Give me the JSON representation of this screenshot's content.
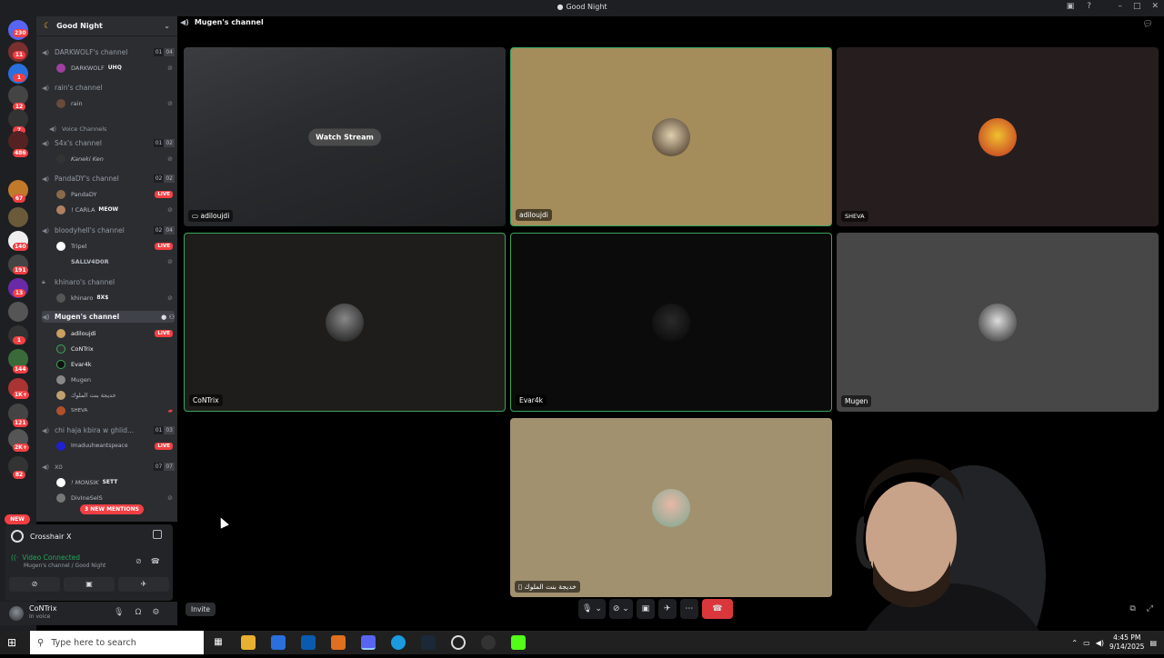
{
  "window": {
    "title": "Good Night",
    "title_icon": "discord-icon"
  },
  "server_rail": {
    "badges": [
      "230",
      "11",
      "1",
      "12",
      "7",
      "486",
      "67",
      "140",
      "191",
      "13",
      "1",
      "144",
      "1K+",
      "121",
      "2K+",
      "82"
    ],
    "new_label": "NEW"
  },
  "sidebar": {
    "guild_name": "Good Night",
    "channels": [
      {
        "name": "DARKWOLF's channel",
        "count": [
          "01",
          "04"
        ]
      },
      {
        "name": "rain's channel"
      },
      {
        "name": "Voice Channels"
      },
      {
        "name": "S4x's channel",
        "count": [
          "01",
          "02"
        ]
      },
      {
        "name": "PandaDY's channel",
        "count": [
          "02",
          "02"
        ]
      },
      {
        "name": "bloodyhell's channel",
        "count": [
          "02",
          "04"
        ]
      },
      {
        "name": "khinaro's channel"
      },
      {
        "name": "Mugen's channel"
      },
      {
        "name": "chi haja kbira w ghlid...",
        "count": [
          "01",
          "03"
        ]
      },
      {
        "name": "xo",
        "count": [
          "07",
          "07"
        ]
      }
    ],
    "users": [
      {
        "name": "DARKWOLF",
        "tag": "UHQ"
      },
      {
        "name": "rain"
      },
      {
        "name": "Kaneki Ken"
      },
      {
        "name": "PandaDY",
        "status": "LIVE"
      },
      {
        "name": "! CARLA",
        "tag": "MEOW"
      },
      {
        "name": "Tripel",
        "status": "LIVE"
      },
      {
        "name": "SALLV4D0R"
      },
      {
        "name": "khinaro",
        "tag": "8X$"
      },
      {
        "name": "adiloujdi",
        "status": "LIVE"
      },
      {
        "name": "CoNTrix"
      },
      {
        "name": "Evar4k"
      },
      {
        "name": "Mugen"
      },
      {
        "name": "خديجة بنت الملوك"
      },
      {
        "name": "SHEVA"
      },
      {
        "name": "Imaduuhwantspeace",
        "status": "LIVE"
      },
      {
        "name": "! MONSIK",
        "tag": "SETT"
      },
      {
        "name": "DivIneSelS"
      }
    ],
    "mentions": "3 NEW MENTIONS"
  },
  "panel": {
    "activity": "Crosshair X",
    "voice_status": "Video Connected",
    "voice_location": "Mugen's channel / Good Night",
    "user_name": "CoNTrix",
    "user_status": "In voice"
  },
  "main": {
    "channel_title": "Mugen's channel",
    "watch_stream": "Watch Stream",
    "tiles": [
      {
        "name": "adiloujdi"
      },
      {
        "name": "adiloujdi"
      },
      {
        "name": "SHEVA"
      },
      {
        "name": "CoNTrix"
      },
      {
        "name": "Evar4k"
      },
      {
        "name": "Mugen"
      },
      {
        "name": "خديجة بنت الملوك"
      }
    ],
    "invite": "Invite"
  },
  "colors": {
    "accent_green": "#3ba55d",
    "live_red": "#f23f43",
    "hangup_red": "#da373c"
  },
  "taskbar": {
    "search_placeholder": "Type here to search",
    "time": "4:45 PM",
    "date": "9/14/2025"
  }
}
